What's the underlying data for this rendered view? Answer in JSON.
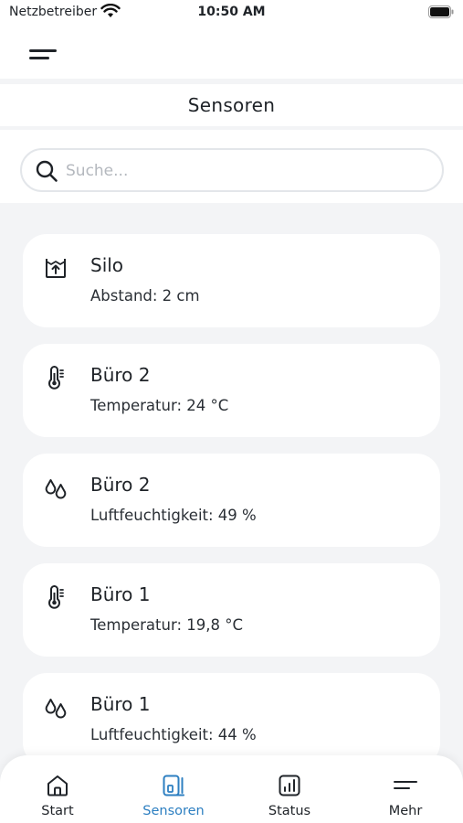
{
  "status_bar": {
    "carrier": "Netzbetreiber",
    "time": "10:50 AM"
  },
  "header": {
    "title": "Sensoren"
  },
  "search": {
    "placeholder": "Suche..."
  },
  "sensors": [
    {
      "icon": "silo-icon",
      "name": "Silo",
      "value": "Abstand: 2 cm"
    },
    {
      "icon": "thermometer-icon",
      "name": "Büro 2",
      "value": "Temperatur: 24 °C"
    },
    {
      "icon": "droplets-icon",
      "name": "Büro 2",
      "value": "Luftfeuchtigkeit: 49 %"
    },
    {
      "icon": "thermometer-icon",
      "name": "Büro 1",
      "value": "Temperatur: 19,8 °C"
    },
    {
      "icon": "droplets-icon",
      "name": "Büro 1",
      "value": "Luftfeuchtigkeit: 44 %"
    }
  ],
  "tabbar": {
    "tabs": [
      {
        "label": "Start",
        "icon": "home-icon",
        "active": false
      },
      {
        "label": "Sensoren",
        "icon": "sensor-icon",
        "active": true
      },
      {
        "label": "Status",
        "icon": "chart-icon",
        "active": false
      },
      {
        "label": "Mehr",
        "icon": "menu-icon",
        "active": false
      }
    ]
  },
  "colors": {
    "accent": "#2d7fc1",
    "background": "#f3f4f6",
    "card": "#ffffff",
    "text": "#1f2328"
  }
}
